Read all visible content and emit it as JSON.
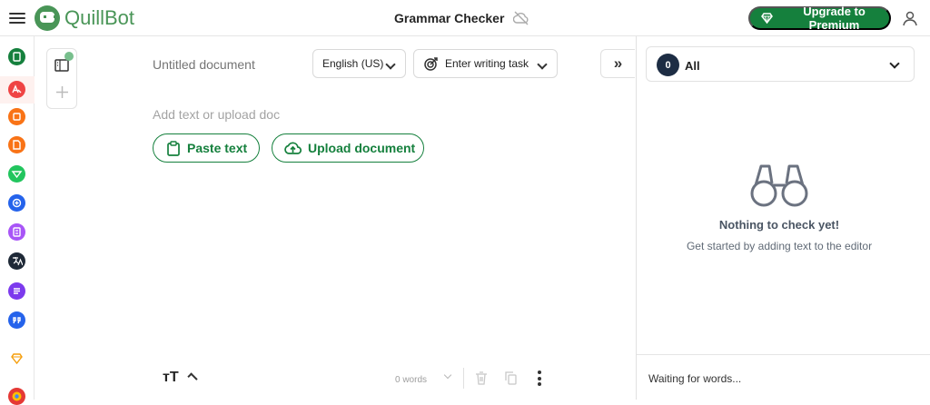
{
  "app": {
    "brand": "QuillBot",
    "title": "Grammar Checker",
    "upgrade_label": "Upgrade to Premium",
    "brand_color": "#499557",
    "primary_color": "#15803d"
  },
  "document": {
    "title_placeholder": "Untitled document",
    "language": "English (US)",
    "writing_task_placeholder": "Enter writing task",
    "editor_placeholder": "Add text or upload doc",
    "paste_label": "Paste text",
    "upload_label": "Upload document"
  },
  "editor_footer": {
    "word_count": "0 words"
  },
  "issues": {
    "count": "0",
    "filter": "All",
    "empty_title": "Nothing to check yet!",
    "empty_subtitle": "Get started by adding text to the editor",
    "status": "Waiting for words..."
  },
  "rail_icons": [
    "grammar-checker-icon",
    "paraphraser-icon",
    "ai-detector-icon",
    "plagiarism-checker-icon",
    "humanizer-icon",
    "ai-chat-icon",
    "summarizer-icon",
    "translator-icon",
    "flow-icon",
    "citation-icon",
    "premium-icon",
    "chrome-icon"
  ]
}
